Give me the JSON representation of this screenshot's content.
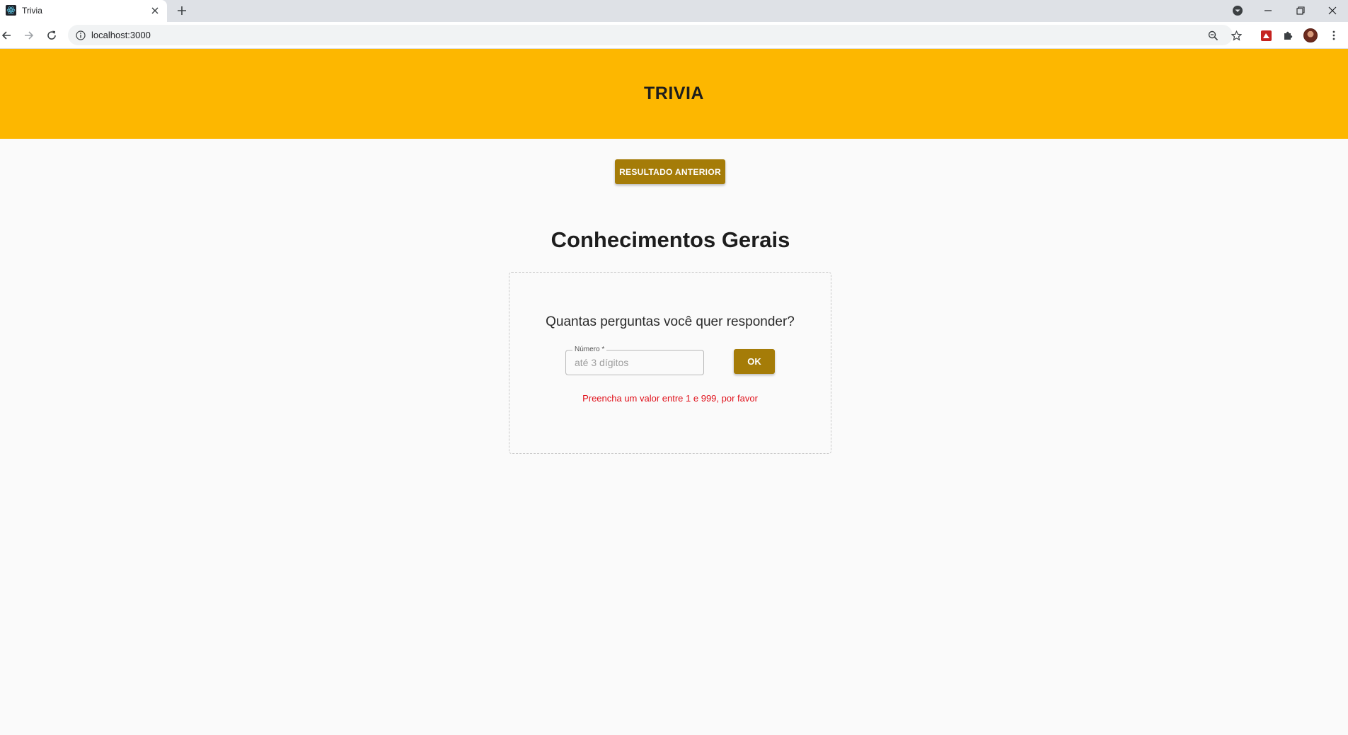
{
  "browser": {
    "tab_title": "Trivia",
    "url": "localhost:3000"
  },
  "app": {
    "title": "TRIVIA",
    "previous_result_label": "RESULTADO ANTERIOR",
    "section_title": "Conhecimentos Gerais",
    "question": "Quantas perguntas você quer responder?",
    "number_field": {
      "label": "Número *",
      "placeholder": "até 3 dígitos",
      "value": ""
    },
    "ok_label": "OK",
    "error_message": "Preencha um valor entre 1 e 999, por favor"
  },
  "colors": {
    "header": "#fdb700",
    "button": "#a57c08",
    "error": "#e0101a",
    "page_background": "#fafafa"
  },
  "icons": {
    "favicon": "react-logo-icon",
    "tab_close": "close-icon",
    "new_tab": "plus-icon",
    "profile_menu": "chevron-down-circle-icon",
    "minimize": "minimize-icon",
    "restore": "restore-icon",
    "window_close": "close-icon",
    "back": "arrow-left-icon",
    "forward": "arrow-right-icon",
    "reload": "reload-icon",
    "site_info": "info-icon",
    "zoom": "zoom-out-icon",
    "bookmark": "star-icon",
    "extension_1": "extension-icon",
    "extensions": "puzzle-icon",
    "menu": "kebab-menu-icon"
  }
}
